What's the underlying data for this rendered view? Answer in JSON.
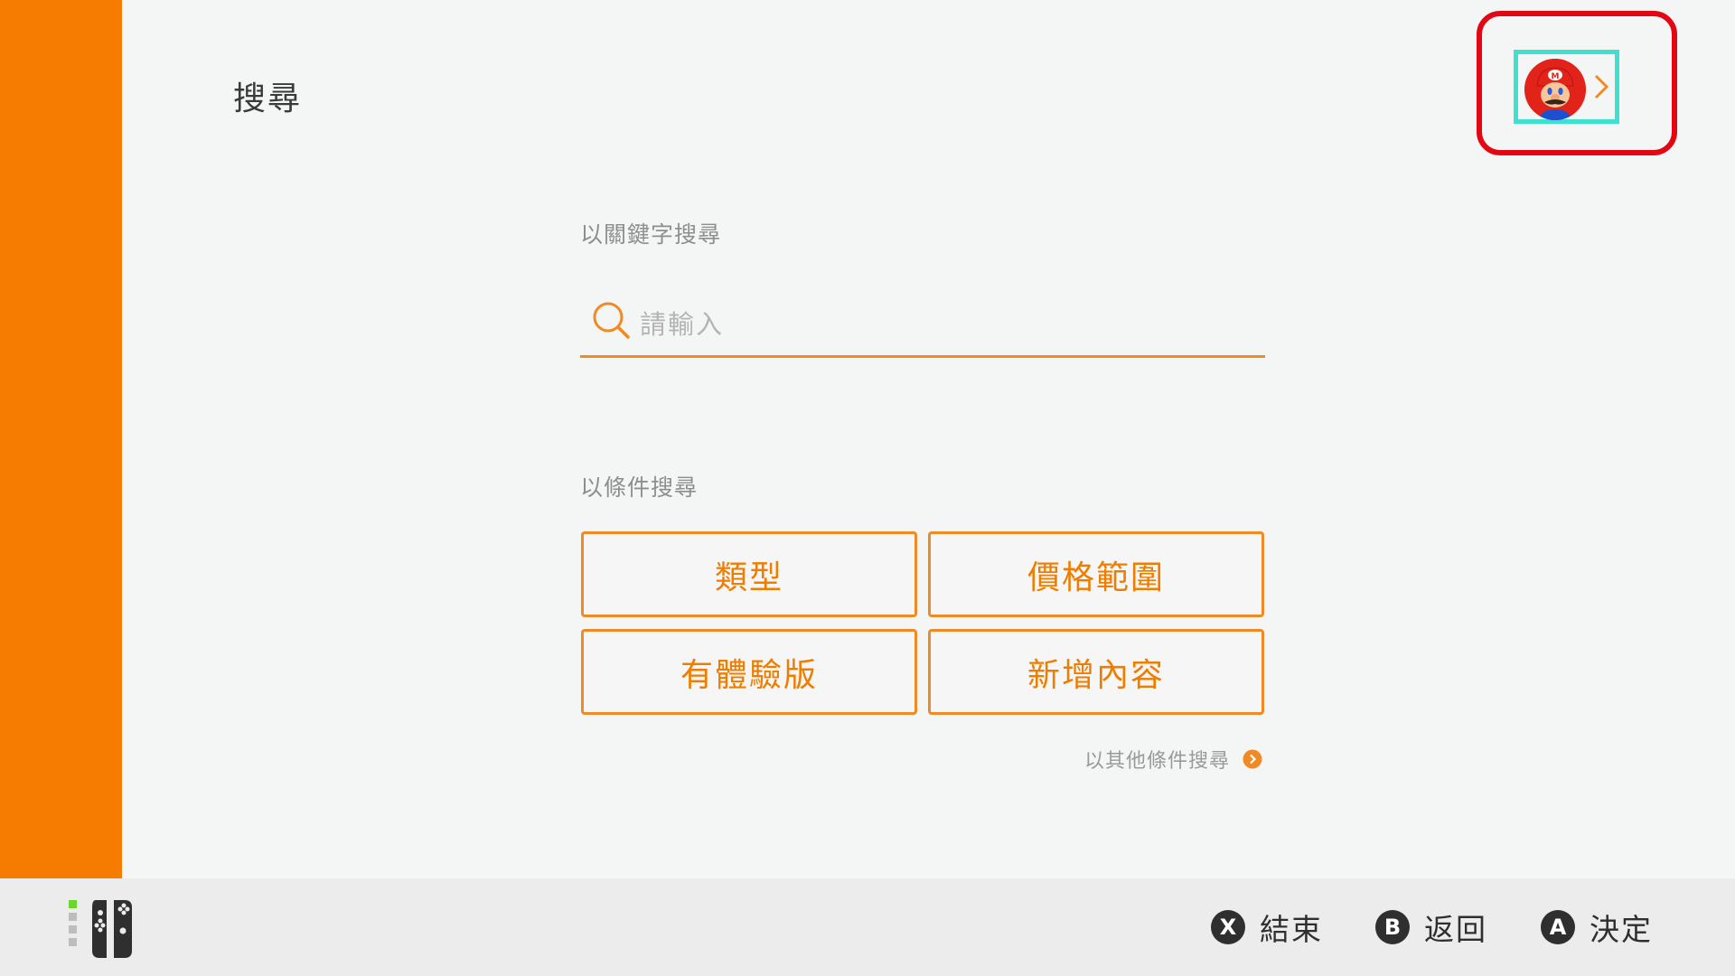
{
  "header": {
    "title": "搜尋"
  },
  "account": {
    "avatar_icon": "mario-avatar-icon",
    "chevron_icon": "chevron-right-icon",
    "highlight_color": "#e30613",
    "focus_color": "#3ee0d0"
  },
  "keyword_search": {
    "section_label": "以關鍵字搜尋",
    "placeholder": "請輸入",
    "icon": "search-icon"
  },
  "condition_search": {
    "section_label": "以條件搜尋",
    "buttons": [
      {
        "label": "類型"
      },
      {
        "label": "價格範圍"
      },
      {
        "label": "有體驗版"
      },
      {
        "label": "新增內容"
      }
    ],
    "more_link": "以其他條件搜尋"
  },
  "footer": {
    "controller_icon": "joycon-controller-icon",
    "hints": [
      {
        "button": "X",
        "label": "結束"
      },
      {
        "button": "B",
        "label": "返回"
      },
      {
        "button": "A",
        "label": "決定"
      }
    ]
  },
  "colors": {
    "accent": "#f57c00",
    "button_border": "#f08a24",
    "button_text": "#ef7d00",
    "background": "#f4f5f5",
    "footer_background": "#ececec"
  }
}
